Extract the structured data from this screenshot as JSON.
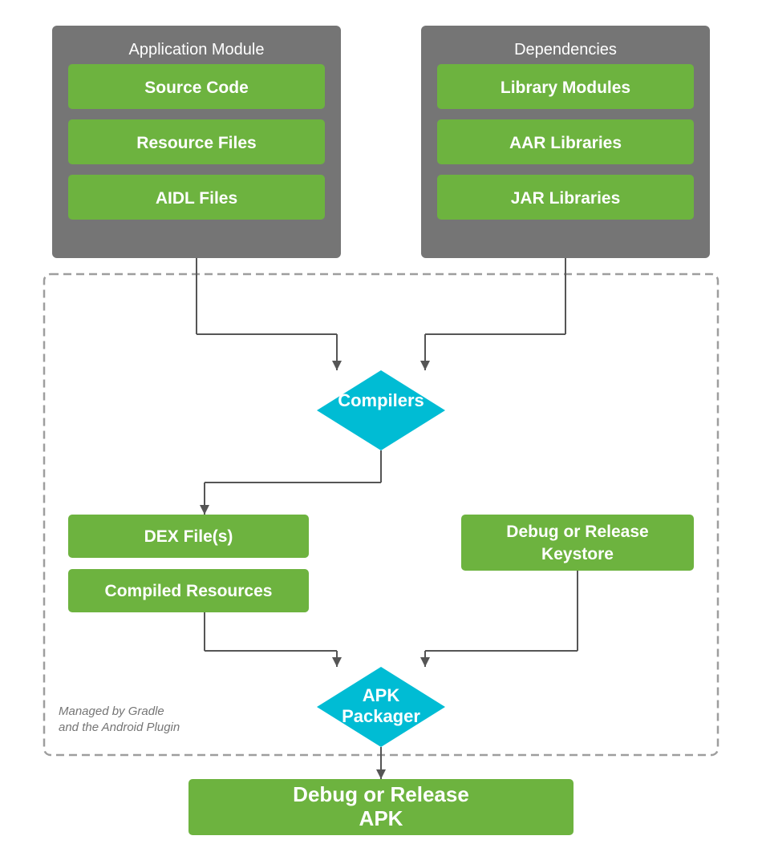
{
  "appModule": {
    "title": "Application Module",
    "items": [
      "Source Code",
      "Resource Files",
      "AIDL Files"
    ]
  },
  "dependencies": {
    "title": "Dependencies",
    "items": [
      "Library Modules",
      "AAR Libraries",
      "JAR Libraries"
    ]
  },
  "compilers": {
    "label": "Compilers"
  },
  "dexFile": {
    "label": "DEX File(s)"
  },
  "compiledResources": {
    "label": "Compiled Resources"
  },
  "keystore": {
    "label": "Debug or Release\nKeystore"
  },
  "apkPackager": {
    "label": "APK\nPackager"
  },
  "finalApk": {
    "label": "Debug or Release\nAPK"
  },
  "gradleNote": {
    "line1": "Managed by Gradle",
    "line2": "and the Android Plugin"
  },
  "colors": {
    "green": "#6DB33F",
    "cyan": "#00BCD4",
    "gray": "#757575",
    "arrowColor": "#555555"
  }
}
